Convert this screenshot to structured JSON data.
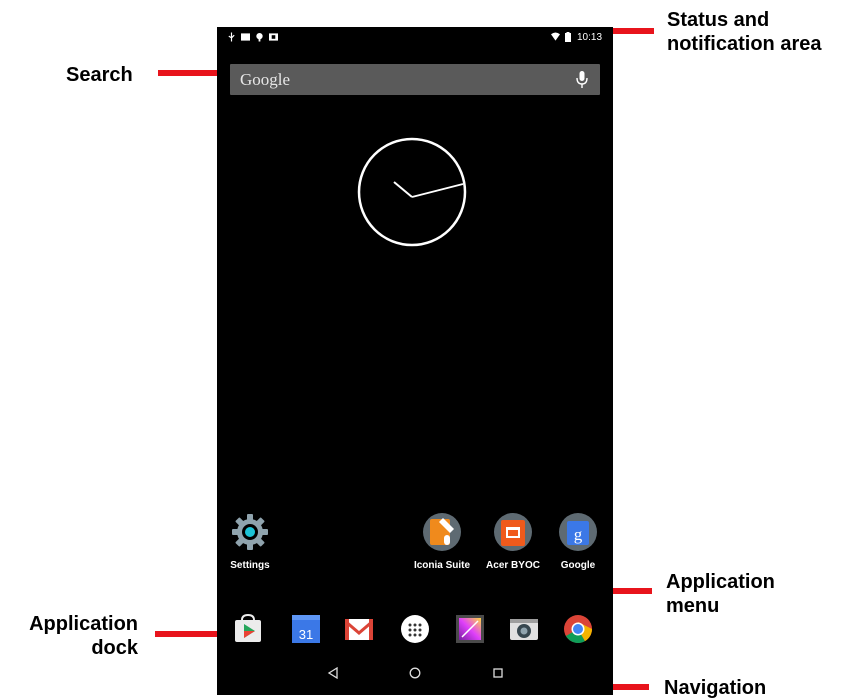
{
  "callouts": {
    "status": "Status and notification area",
    "search": "Search",
    "app_menu": "Application menu",
    "dock": "Application dock",
    "navigation": "Navigation"
  },
  "status_bar": {
    "time": "10:13"
  },
  "search": {
    "brand": "Google",
    "mic_icon": "microphone-icon"
  },
  "home_apps": [
    {
      "label": "Settings",
      "icon": "settings-gear-icon"
    },
    {
      "label": "Iconia Suite",
      "icon": "iconia-suite-icon"
    },
    {
      "label": "Acer BYOC",
      "icon": "acer-byoc-icon"
    },
    {
      "label": "Google",
      "icon": "google-search-app-icon"
    }
  ],
  "dock": {
    "calendar_date": "31",
    "icons": [
      "play-store-icon",
      "calendar-icon",
      "gmail-icon",
      "app-drawer-icon",
      "gallery-icon",
      "camera-icon",
      "chrome-icon"
    ]
  },
  "navigation": {
    "icons": [
      "back-icon",
      "home-icon",
      "recents-icon"
    ]
  },
  "colors": {
    "callout_line": "#e8141c",
    "screen_bg": "#000000"
  }
}
